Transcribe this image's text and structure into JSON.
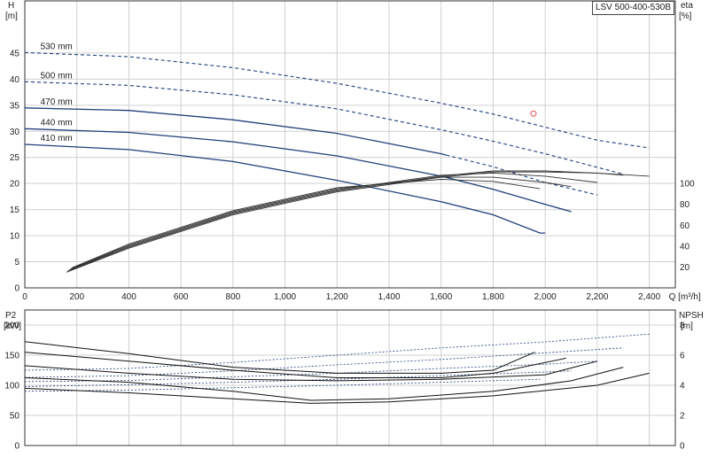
{
  "model_label": "LSV 500-400-530B",
  "chart_data": [
    {
      "type": "line",
      "name_panel": "head-efficiency",
      "left_axis_label": [
        "H",
        "[m]"
      ],
      "right_axis_label": [
        "eta",
        "[%]"
      ],
      "xlabel": "Q [m³/h]",
      "xlim": [
        0,
        2500
      ],
      "x_ticks": [
        0,
        200,
        400,
        600,
        800,
        1000,
        1200,
        1400,
        1600,
        1800,
        2000,
        2200,
        2400
      ],
      "x_tick_labels": [
        "0",
        "200",
        "400",
        "600",
        "800",
        "1,000",
        "1,200",
        "1,400",
        "1,600",
        "1,800",
        "2,000",
        "2,200",
        "2,400"
      ],
      "ylim": [
        0,
        55
      ],
      "y_ticks": [
        0,
        5,
        10,
        15,
        20,
        25,
        30,
        35,
        40,
        45
      ],
      "y2lim": [
        0,
        275
      ],
      "y2_ticks": [
        20,
        40,
        60,
        80,
        100
      ],
      "grid": true,
      "colors": {
        "head": "#1f3f7a",
        "efficiency": "#333333",
        "marker": "#e05050",
        "axis": "#333333",
        "grid": "#d0d0d0"
      },
      "head_curves": [
        {
          "label": "530 mm",
          "solid_until": 0,
          "points": [
            [
              0,
              45.1
            ],
            [
              400,
              44.3
            ],
            [
              800,
              42.2
            ],
            [
              1200,
              39.2
            ],
            [
              1600,
              35.4
            ],
            [
              1800,
              33.3
            ],
            [
              2000,
              30.8
            ],
            [
              2200,
              28.3
            ],
            [
              2400,
              26.8
            ]
          ]
        },
        {
          "label": "500 mm",
          "solid_until": 0,
          "points": [
            [
              0,
              39.5
            ],
            [
              400,
              38.8
            ],
            [
              800,
              37.0
            ],
            [
              1200,
              34.3
            ],
            [
              1600,
              30.3
            ],
            [
              1800,
              28.1
            ],
            [
              2000,
              25.7
            ],
            [
              2200,
              23.1
            ],
            [
              2300,
              21.8
            ]
          ]
        },
        {
          "label": "470 mm",
          "solid_until": 1620,
          "points": [
            [
              0,
              34.5
            ],
            [
              400,
              34.0
            ],
            [
              800,
              32.2
            ],
            [
              1200,
              29.6
            ],
            [
              1600,
              25.7
            ],
            [
              1800,
              23.2
            ],
            [
              2000,
              20.2
            ],
            [
              2100,
              19.0
            ],
            [
              2200,
              17.8
            ]
          ]
        },
        {
          "label": "440 mm",
          "solid_until": 2100,
          "points": [
            [
              0,
              30.5
            ],
            [
              400,
              29.8
            ],
            [
              800,
              28.0
            ],
            [
              1200,
              25.3
            ],
            [
              1600,
              21.4
            ],
            [
              1800,
              18.9
            ],
            [
              2000,
              16.0
            ],
            [
              2100,
              14.6
            ]
          ]
        },
        {
          "label": "410 mm",
          "solid_until": 2000,
          "points": [
            [
              0,
              27.5
            ],
            [
              400,
              26.5
            ],
            [
              800,
              24.2
            ],
            [
              1200,
              20.6
            ],
            [
              1600,
              16.5
            ],
            [
              1800,
              14.0
            ],
            [
              1980,
              10.5
            ]
          ]
        }
      ],
      "efficiency_curves": [
        {
          "label": "530 mm",
          "points": [
            [
              160,
              15
            ],
            [
              400,
              38
            ],
            [
              800,
              70
            ],
            [
              1200,
              92
            ],
            [
              1600,
              106
            ],
            [
              1800,
              111
            ],
            [
              2000,
              111
            ],
            [
              2200,
              110
            ],
            [
              2400,
              107
            ]
          ]
        },
        {
          "label": "500 mm",
          "points": [
            [
              165,
              16
            ],
            [
              400,
              39
            ],
            [
              800,
              71
            ],
            [
              1200,
              93
            ],
            [
              1600,
              107
            ],
            [
              1800,
              112
            ],
            [
              2000,
              112
            ],
            [
              2200,
              110
            ],
            [
              2300,
              108
            ]
          ]
        },
        {
          "label": "470 mm",
          "points": [
            [
              170,
              17
            ],
            [
              400,
              40
            ],
            [
              800,
              72
            ],
            [
              1200,
              94
            ],
            [
              1600,
              108
            ],
            [
              1800,
              110
            ],
            [
              2000,
              107
            ],
            [
              2200,
              101
            ]
          ]
        },
        {
          "label": "440 mm",
          "points": [
            [
              175,
              18
            ],
            [
              400,
              41
            ],
            [
              800,
              73
            ],
            [
              1200,
              95
            ],
            [
              1600,
              106
            ],
            [
              1800,
              106
            ],
            [
              2000,
              101
            ],
            [
              2100,
              97
            ]
          ]
        },
        {
          "label": "410 mm",
          "points": [
            [
              180,
              19
            ],
            [
              400,
              42
            ],
            [
              800,
              74
            ],
            [
              1200,
              96
            ],
            [
              1600,
              104
            ],
            [
              1800,
              102
            ],
            [
              1980,
              95
            ]
          ]
        }
      ],
      "marker": {
        "x": 1955,
        "y": 33.4
      }
    },
    {
      "type": "line",
      "name_panel": "power-npsh",
      "left_axis_label": [
        "P2",
        "[kW]"
      ],
      "right_axis_label": [
        "NPSH",
        "[m]"
      ],
      "xlim": [
        0,
        2500
      ],
      "ylim": [
        0,
        225
      ],
      "y_ticks": [
        0,
        50,
        100,
        150,
        200
      ],
      "y2lim": [
        0,
        9
      ],
      "y2_ticks": [
        0,
        2,
        4,
        6,
        8
      ],
      "grid": true,
      "power_curves": [
        {
          "label": "530 mm",
          "points": [
            [
              0,
              125
            ],
            [
              400,
              128
            ],
            [
              800,
              138
            ],
            [
              1200,
              150
            ],
            [
              1600,
              162
            ],
            [
              2000,
              172
            ],
            [
              2400,
              185
            ]
          ]
        },
        {
          "label": "500 mm",
          "points": [
            [
              0,
              113
            ],
            [
              400,
              116
            ],
            [
              800,
              124
            ],
            [
              1200,
              134
            ],
            [
              1600,
              143
            ],
            [
              2000,
              154
            ],
            [
              2300,
              162
            ]
          ]
        },
        {
          "label": "470 mm",
          "points": [
            [
              0,
              106
            ],
            [
              400,
              108
            ],
            [
              800,
              114
            ],
            [
              1200,
              120
            ],
            [
              1600,
              128
            ],
            [
              2000,
              135
            ],
            [
              2200,
              140
            ]
          ]
        },
        {
          "label": "440 mm",
          "points": [
            [
              0,
              98
            ],
            [
              400,
              101
            ],
            [
              800,
              105
            ],
            [
              1200,
              110
            ],
            [
              1600,
              116
            ],
            [
              2000,
              122
            ],
            [
              2100,
              124
            ]
          ]
        },
        {
          "label": "410 mm",
          "points": [
            [
              0,
              90
            ],
            [
              400,
              92
            ],
            [
              800,
              96
            ],
            [
              1200,
              100
            ],
            [
              1600,
              105
            ],
            [
              1980,
              110
            ]
          ]
        }
      ],
      "npsh_curves": [
        {
          "label": "530 mm",
          "points": [
            [
              0,
              6.9
            ],
            [
              400,
              6.1
            ],
            [
              800,
              5.2
            ],
            [
              1200,
              4.8
            ],
            [
              1600,
              4.8
            ],
            [
              1800,
              5.0
            ],
            [
              1960,
              6.2
            ]
          ]
        },
        {
          "label": "500 mm",
          "points": [
            [
              0,
              6.2
            ],
            [
              400,
              5.6
            ],
            [
              800,
              5.0
            ],
            [
              1200,
              4.5
            ],
            [
              1600,
              4.5
            ],
            [
              1800,
              4.8
            ],
            [
              2080,
              5.8
            ]
          ]
        },
        {
          "label": "470 mm",
          "points": [
            [
              0,
              5.3
            ],
            [
              400,
              4.8
            ],
            [
              800,
              4.4
            ],
            [
              1200,
              4.3
            ],
            [
              1600,
              4.4
            ],
            [
              2000,
              4.7
            ],
            [
              2200,
              5.6
            ]
          ]
        },
        {
          "label": "440 mm",
          "points": [
            [
              0,
              4.5
            ],
            [
              400,
              4.2
            ],
            [
              800,
              3.6
            ],
            [
              1100,
              3.0
            ],
            [
              1400,
              3.1
            ],
            [
              1800,
              3.6
            ],
            [
              2100,
              4.3
            ],
            [
              2300,
              5.2
            ]
          ]
        },
        {
          "label": "410 mm",
          "points": [
            [
              0,
              3.8
            ],
            [
              400,
              3.5
            ],
            [
              800,
              3.1
            ],
            [
              1100,
              2.8
            ],
            [
              1400,
              2.9
            ],
            [
              1800,
              3.3
            ],
            [
              2200,
              4.0
            ],
            [
              2400,
              4.8
            ]
          ]
        }
      ]
    }
  ]
}
